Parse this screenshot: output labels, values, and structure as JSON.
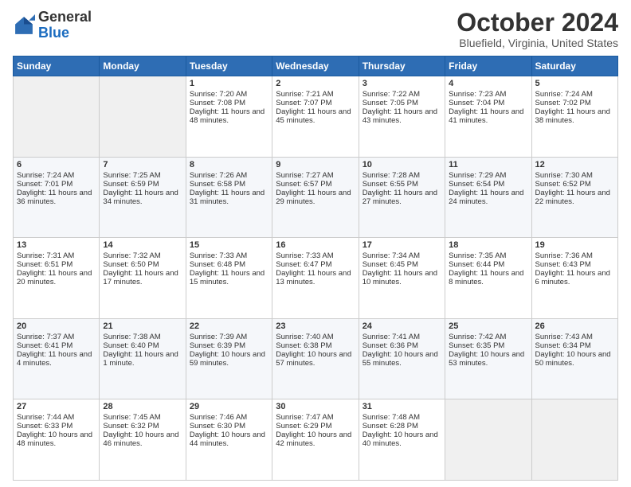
{
  "header": {
    "logo_general": "General",
    "logo_blue": "Blue",
    "month_title": "October 2024",
    "location": "Bluefield, Virginia, United States"
  },
  "days_of_week": [
    "Sunday",
    "Monday",
    "Tuesday",
    "Wednesday",
    "Thursday",
    "Friday",
    "Saturday"
  ],
  "weeks": [
    [
      {
        "day": "",
        "content": ""
      },
      {
        "day": "",
        "content": ""
      },
      {
        "day": "1",
        "content": "Sunrise: 7:20 AM\nSunset: 7:08 PM\nDaylight: 11 hours and 48 minutes."
      },
      {
        "day": "2",
        "content": "Sunrise: 7:21 AM\nSunset: 7:07 PM\nDaylight: 11 hours and 45 minutes."
      },
      {
        "day": "3",
        "content": "Sunrise: 7:22 AM\nSunset: 7:05 PM\nDaylight: 11 hours and 43 minutes."
      },
      {
        "day": "4",
        "content": "Sunrise: 7:23 AM\nSunset: 7:04 PM\nDaylight: 11 hours and 41 minutes."
      },
      {
        "day": "5",
        "content": "Sunrise: 7:24 AM\nSunset: 7:02 PM\nDaylight: 11 hours and 38 minutes."
      }
    ],
    [
      {
        "day": "6",
        "content": "Sunrise: 7:24 AM\nSunset: 7:01 PM\nDaylight: 11 hours and 36 minutes."
      },
      {
        "day": "7",
        "content": "Sunrise: 7:25 AM\nSunset: 6:59 PM\nDaylight: 11 hours and 34 minutes."
      },
      {
        "day": "8",
        "content": "Sunrise: 7:26 AM\nSunset: 6:58 PM\nDaylight: 11 hours and 31 minutes."
      },
      {
        "day": "9",
        "content": "Sunrise: 7:27 AM\nSunset: 6:57 PM\nDaylight: 11 hours and 29 minutes."
      },
      {
        "day": "10",
        "content": "Sunrise: 7:28 AM\nSunset: 6:55 PM\nDaylight: 11 hours and 27 minutes."
      },
      {
        "day": "11",
        "content": "Sunrise: 7:29 AM\nSunset: 6:54 PM\nDaylight: 11 hours and 24 minutes."
      },
      {
        "day": "12",
        "content": "Sunrise: 7:30 AM\nSunset: 6:52 PM\nDaylight: 11 hours and 22 minutes."
      }
    ],
    [
      {
        "day": "13",
        "content": "Sunrise: 7:31 AM\nSunset: 6:51 PM\nDaylight: 11 hours and 20 minutes."
      },
      {
        "day": "14",
        "content": "Sunrise: 7:32 AM\nSunset: 6:50 PM\nDaylight: 11 hours and 17 minutes."
      },
      {
        "day": "15",
        "content": "Sunrise: 7:33 AM\nSunset: 6:48 PM\nDaylight: 11 hours and 15 minutes."
      },
      {
        "day": "16",
        "content": "Sunrise: 7:33 AM\nSunset: 6:47 PM\nDaylight: 11 hours and 13 minutes."
      },
      {
        "day": "17",
        "content": "Sunrise: 7:34 AM\nSunset: 6:45 PM\nDaylight: 11 hours and 10 minutes."
      },
      {
        "day": "18",
        "content": "Sunrise: 7:35 AM\nSunset: 6:44 PM\nDaylight: 11 hours and 8 minutes."
      },
      {
        "day": "19",
        "content": "Sunrise: 7:36 AM\nSunset: 6:43 PM\nDaylight: 11 hours and 6 minutes."
      }
    ],
    [
      {
        "day": "20",
        "content": "Sunrise: 7:37 AM\nSunset: 6:41 PM\nDaylight: 11 hours and 4 minutes."
      },
      {
        "day": "21",
        "content": "Sunrise: 7:38 AM\nSunset: 6:40 PM\nDaylight: 11 hours and 1 minute."
      },
      {
        "day": "22",
        "content": "Sunrise: 7:39 AM\nSunset: 6:39 PM\nDaylight: 10 hours and 59 minutes."
      },
      {
        "day": "23",
        "content": "Sunrise: 7:40 AM\nSunset: 6:38 PM\nDaylight: 10 hours and 57 minutes."
      },
      {
        "day": "24",
        "content": "Sunrise: 7:41 AM\nSunset: 6:36 PM\nDaylight: 10 hours and 55 minutes."
      },
      {
        "day": "25",
        "content": "Sunrise: 7:42 AM\nSunset: 6:35 PM\nDaylight: 10 hours and 53 minutes."
      },
      {
        "day": "26",
        "content": "Sunrise: 7:43 AM\nSunset: 6:34 PM\nDaylight: 10 hours and 50 minutes."
      }
    ],
    [
      {
        "day": "27",
        "content": "Sunrise: 7:44 AM\nSunset: 6:33 PM\nDaylight: 10 hours and 48 minutes."
      },
      {
        "day": "28",
        "content": "Sunrise: 7:45 AM\nSunset: 6:32 PM\nDaylight: 10 hours and 46 minutes."
      },
      {
        "day": "29",
        "content": "Sunrise: 7:46 AM\nSunset: 6:30 PM\nDaylight: 10 hours and 44 minutes."
      },
      {
        "day": "30",
        "content": "Sunrise: 7:47 AM\nSunset: 6:29 PM\nDaylight: 10 hours and 42 minutes."
      },
      {
        "day": "31",
        "content": "Sunrise: 7:48 AM\nSunset: 6:28 PM\nDaylight: 10 hours and 40 minutes."
      },
      {
        "day": "",
        "content": ""
      },
      {
        "day": "",
        "content": ""
      }
    ]
  ]
}
